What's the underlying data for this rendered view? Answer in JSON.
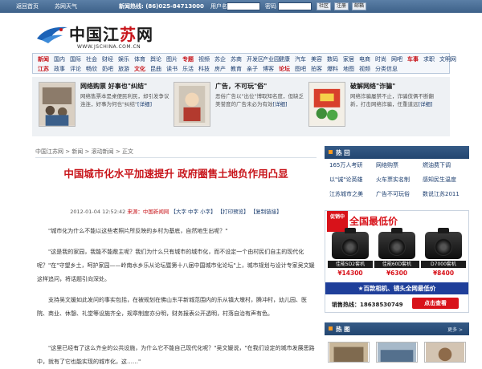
{
  "topbar": {
    "links": [
      "返回首页",
      "苏网天气"
    ],
    "hotline": "新闻热线: (86)025-84713000",
    "username_label": "用户名",
    "password_label": "密码",
    "buttons": [
      "社区",
      "注册",
      "邮箱"
    ]
  },
  "logo": {
    "text_a": "中国江",
    "text_b": "苏",
    "text_c": "网",
    "url": "WWW.JSCHINA.COM.CN"
  },
  "nav": {
    "row1": [
      "新闻",
      "国内",
      "国际",
      "社会",
      "财经",
      "娱乐",
      "体育",
      "舆论",
      "图片",
      "专题",
      "视频",
      "苏企",
      "苏商",
      "开发区",
      "产业园",
      "健康",
      "汽车",
      "美容",
      "数码",
      "家居",
      "电商",
      "时尚",
      "网吧",
      "车事",
      "求职",
      "文明网"
    ],
    "row2": [
      "江苏",
      "政事",
      "评论",
      "畅欣",
      "奶吧",
      "旅游",
      "文化",
      "昆曲",
      "读书",
      "乐活",
      "科技",
      "房产",
      "教育",
      "亲子",
      "博客",
      "论坛",
      "图吧",
      "拍客",
      "爆料",
      "地图",
      "视频",
      "分类信息"
    ]
  },
  "features": [
    {
      "title": "网络购票 好事也\"纠结\"",
      "desc": "网络售票本是桌便民利民，却引发争议连连，好事为何也\"纠结\"",
      "more": "[详细]"
    },
    {
      "title": "广告，不可玩\"俗\"",
      "desc": "恶俗广告以\"出位\"博取知名度，但缺乏美誉度的广告未必为有效",
      "more": "[详细]"
    },
    {
      "title": "破解网络\"诈骗\"",
      "desc": "网络诈骗屡禁不止，诈骗伎俩不断翻新，打击网络诈骗，任重道远",
      "more": "[详细]"
    }
  ],
  "breadcrumb": "中国江苏网 > 新闻 > 滚动新闻 > 正文",
  "article": {
    "title": "中国城市化水平加速提升  政府圈售土地负作用凸显",
    "date": "2012-01-04 12:52:42",
    "source_label": "来源：",
    "source": "中国新闻网",
    "font_sizes": "【大字  中字  小字】",
    "print": "【打印预览】",
    "copy": "【复制链接】",
    "paragraphs": [
      "\"城市化为什么不能以这些老照片所反映的乡村为基底，自然地生出呢？\"",
      "\"这是我的家园，我能不能敞主呢？我们为什么只有城市的城市化，而不设定一个由村民们自主的现代化呢？\"在\"守望乡土，呵护家园——岭南水乡乐从论坛暨第十八届中国城市化论坛\"上，城市规划与设计专家吴文媛这样追问，将话题引向深处。",
      "支持吴文媛如此发问的事实包括，在被规划在佛山东平新城范围内的乐从镇大墩村，腾冲村，幼儿园、医院、商业、休憩、礼堂等设施齐全，规章制度亦分明，财务报表公开透明，村落自治有声有色。",
      "\"这里已经有了这么齐全的公共设施，为什么它不能自己现代化呢？\"吴文媛说，\"在我们设定的城市发展思路中，就有了它也能实现的城市化，这……\""
    ]
  },
  "sidebar": {
    "hot_title": "热 回",
    "hot_items": [
      [
        "165万人考研",
        "网络购票",
        "燃油费下调"
      ],
      [
        "以\"诚\"论英雄",
        "火车票实名制",
        "感知民生温度"
      ],
      [
        "江苏城市之美",
        "广告不可玩俗",
        "数说江苏2011"
      ]
    ],
    "ad": {
      "badge": "促销中",
      "headline": "全国最低价",
      "cameras": [
        {
          "model": "佳能5D2套机",
          "price": "¥14300"
        },
        {
          "model": "佳能60D套机",
          "price": "¥6300"
        },
        {
          "model": "D7000套机",
          "price": "¥8400"
        }
      ],
      "slogan": "★百款相机、镜头全网最低价",
      "phone": "销售热线：18638530749",
      "buy": "点击查看"
    },
    "pics_title": "热 图",
    "pics_more": "更多 >"
  },
  "colors": {
    "accent_red": "#c8141a",
    "nav_blue": "#1a3c6e",
    "header_blue": "#234670"
  }
}
